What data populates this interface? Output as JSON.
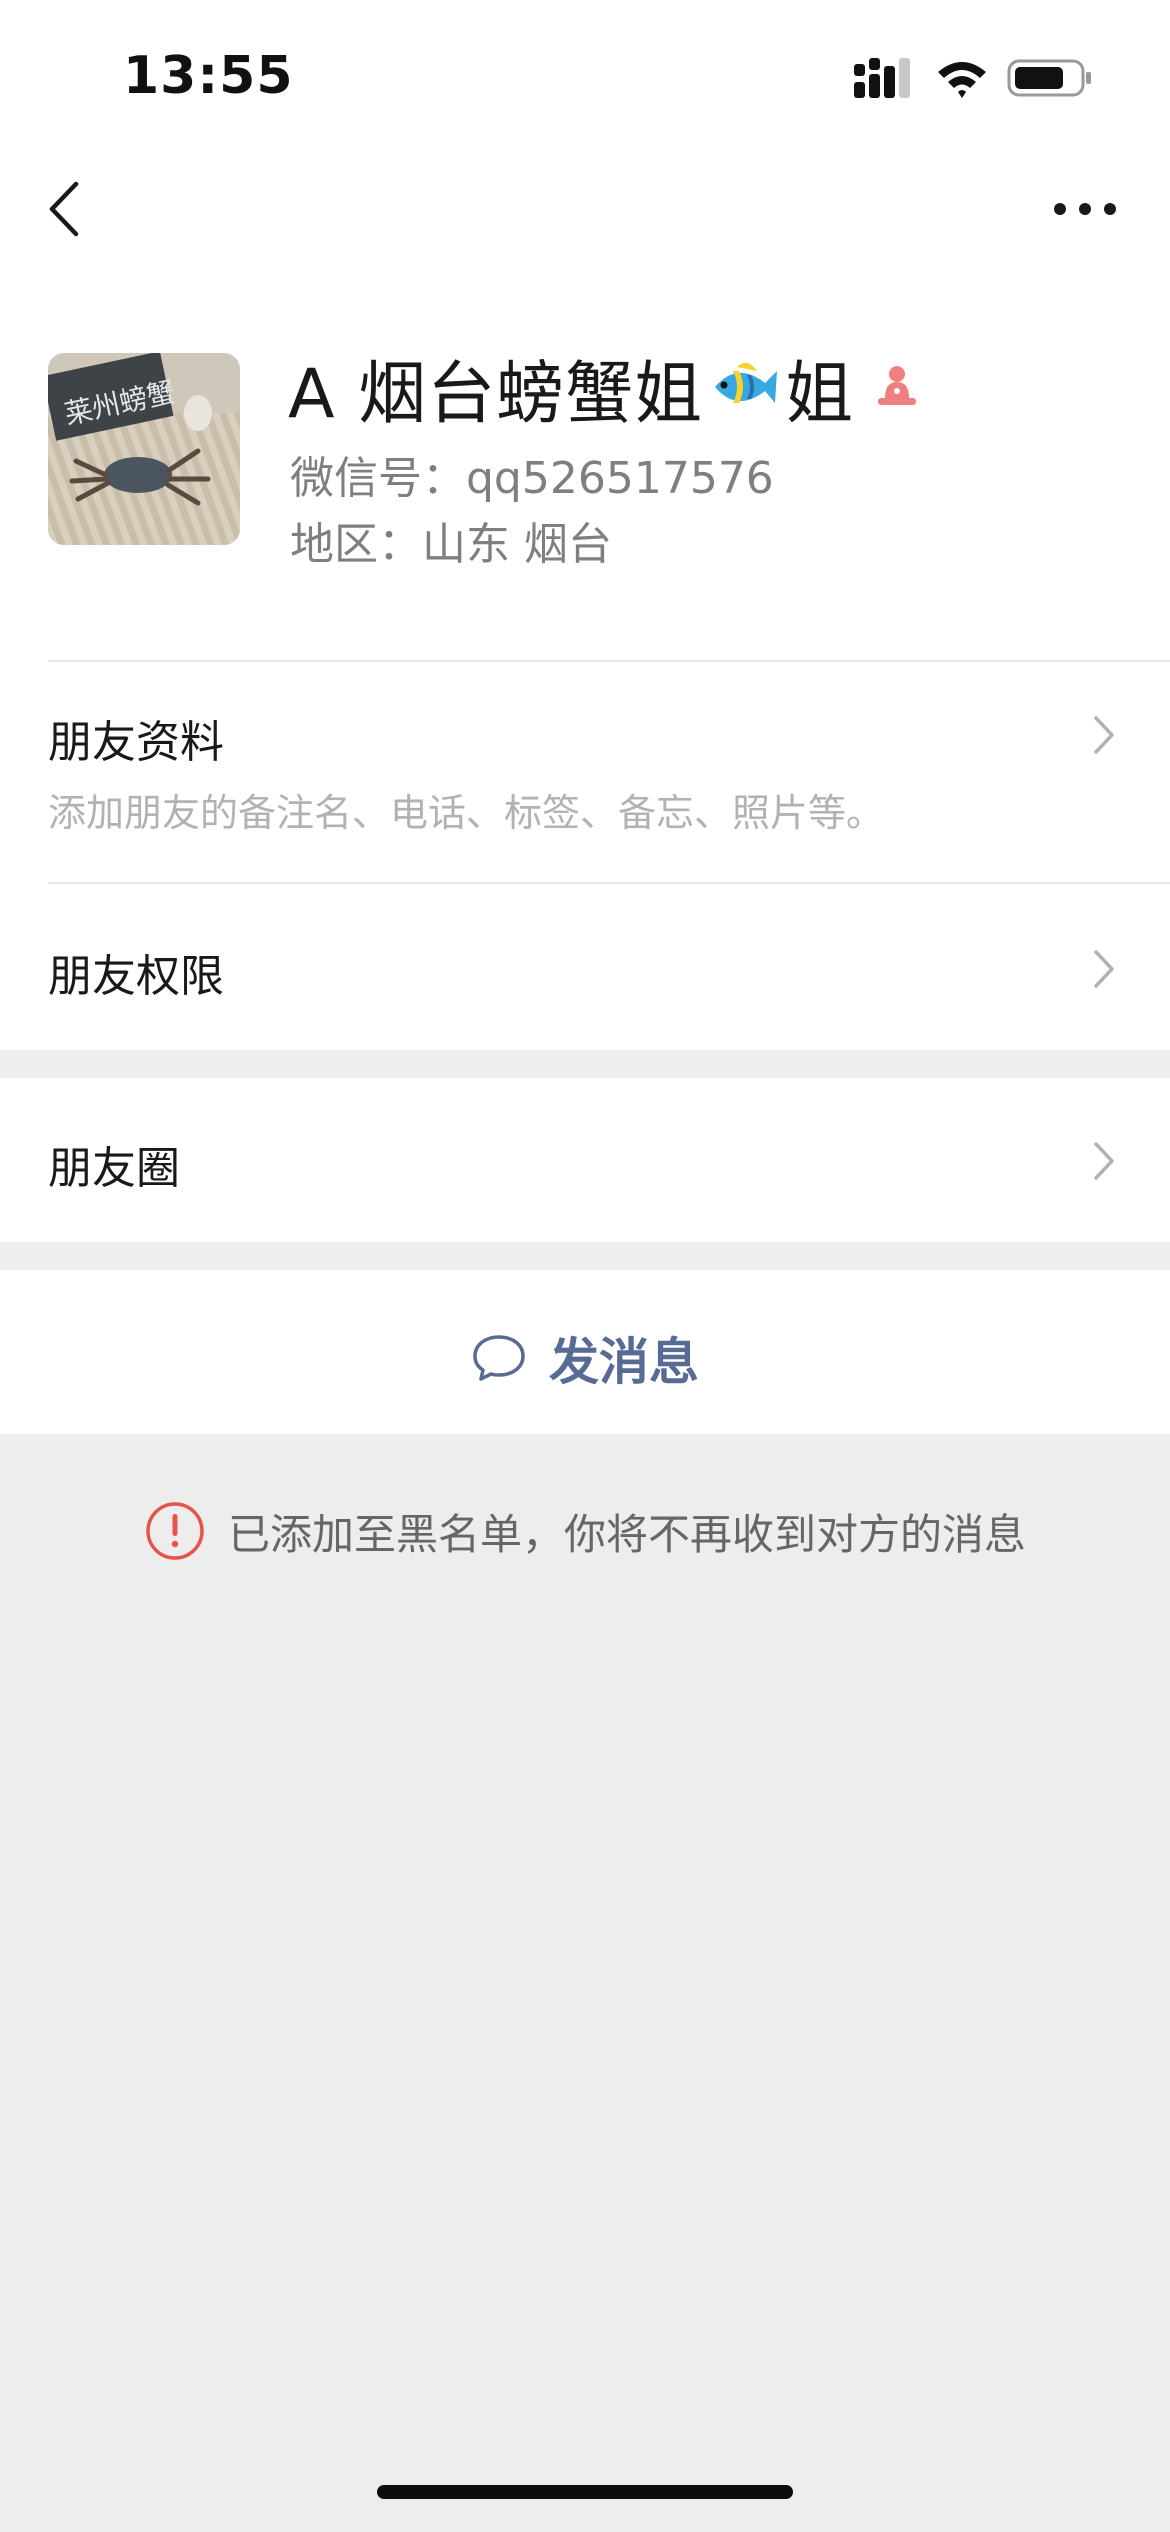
{
  "status_bar": {
    "time": "13:55"
  },
  "profile": {
    "name_prefix": "A 烟台螃蟹姐",
    "name_suffix": "姐",
    "wechat_id": "微信号：qq526517576",
    "region": "地区：山东 烟台",
    "avatar_text": "莱州螃蟹",
    "emoji_icon": "tropical-fish-emoji",
    "gender_icon": "female-icon"
  },
  "rows": {
    "friend_info_title": "朋友资料",
    "friend_info_sub": "添加朋友的备注名、电话、标签、备忘、照片等。",
    "friend_perm_title": "朋友权限",
    "moments_title": "朋友圈"
  },
  "actions": {
    "send_message": "发消息"
  },
  "notice": {
    "blacklist": "已添加至黑名单，你将不再收到对方的消息"
  },
  "colors": {
    "link": "#576b95",
    "warn": "#e5534b",
    "background": "#ededed"
  }
}
